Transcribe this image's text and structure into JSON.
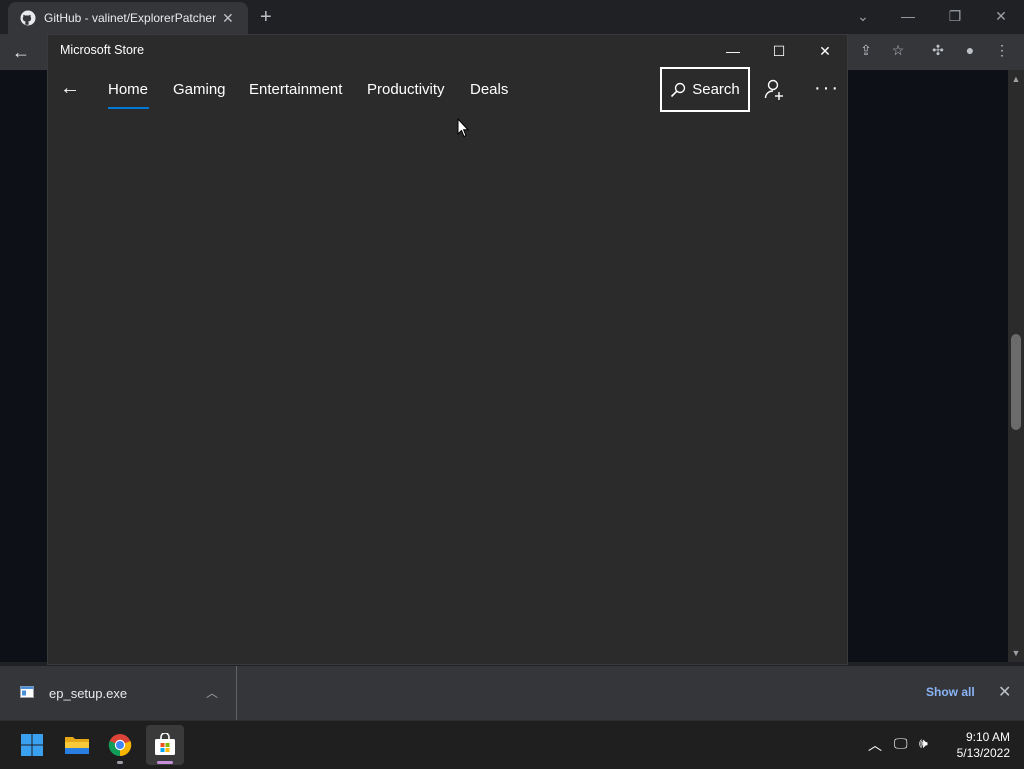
{
  "chrome": {
    "tab_title": "GitHub - valinet/ExplorerPatcher",
    "tab_close": "✕",
    "new_tab": "+"
  },
  "store": {
    "window_title": "Microsoft Store",
    "nav": {
      "items": [
        "Home",
        "Gaming",
        "Entertainment",
        "Productivity",
        "Deals"
      ],
      "active": "Home"
    },
    "search_label": "Search",
    "more_label": "···"
  },
  "downloads": {
    "file_name": "ep_setup.exe",
    "show_all": "Show all"
  },
  "taskbar": {
    "time": "9:10 AM",
    "date": "5/13/2022"
  },
  "colors": {
    "accent": "#0078d4",
    "store_bg": "#2b2b2b",
    "taskbar_bg": "#1f1f1f",
    "link": "#8ab4f8"
  },
  "icons": {
    "github": "github-icon",
    "search": "search-icon",
    "account": "add-account-icon",
    "store": "store-icon",
    "explorer": "folder-icon",
    "chrome": "chrome-icon",
    "windows": "windows-start-icon"
  }
}
